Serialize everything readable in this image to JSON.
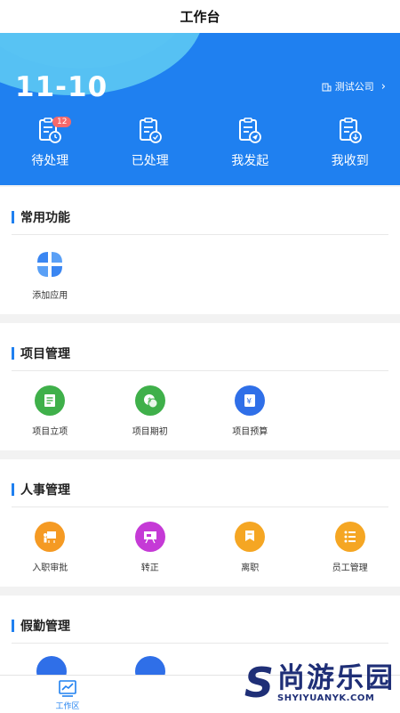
{
  "header": {
    "title": "工作台"
  },
  "hero": {
    "date": "11-10",
    "company": "测试公司",
    "quick_actions": [
      {
        "label": "待处理",
        "badge": "12",
        "icon": "pending-doc-icon"
      },
      {
        "label": "已处理",
        "icon": "processed-doc-icon"
      },
      {
        "label": "我发起",
        "icon": "initiated-doc-icon"
      },
      {
        "label": "我收到",
        "icon": "received-doc-icon"
      }
    ]
  },
  "sections": [
    {
      "title": "常用功能",
      "items": [
        {
          "label": "添加应用",
          "icon": "add-app-icon",
          "color": "#3a86f2"
        }
      ]
    },
    {
      "title": "项目管理",
      "items": [
        {
          "label": "项目立项",
          "icon": "project-setup-icon",
          "color": "#3fb04a"
        },
        {
          "label": "项目期初",
          "icon": "project-opening-icon",
          "color": "#3fb04a"
        },
        {
          "label": "项目预算",
          "icon": "project-budget-icon",
          "color": "#2f6fe8"
        }
      ]
    },
    {
      "title": "人事管理",
      "items": [
        {
          "label": "入职审批",
          "icon": "onboarding-approval-icon",
          "color": "#f59a23"
        },
        {
          "label": "转正",
          "icon": "regularization-icon",
          "color": "#c53ad6"
        },
        {
          "label": "离职",
          "icon": "resignation-icon",
          "color": "#f5a623"
        },
        {
          "label": "员工管理",
          "icon": "employee-management-icon",
          "color": "#f5a623"
        }
      ]
    },
    {
      "title": "假勤管理",
      "items": []
    }
  ],
  "bottom_nav": {
    "active_tab": "工作区"
  },
  "watermark": {
    "cn": "尚游乐园",
    "en": "SHYIYUANYK.COM",
    "logo": "S"
  },
  "colors": {
    "primary": "#1f80f0",
    "accent_wave": "#5cc8f3"
  }
}
